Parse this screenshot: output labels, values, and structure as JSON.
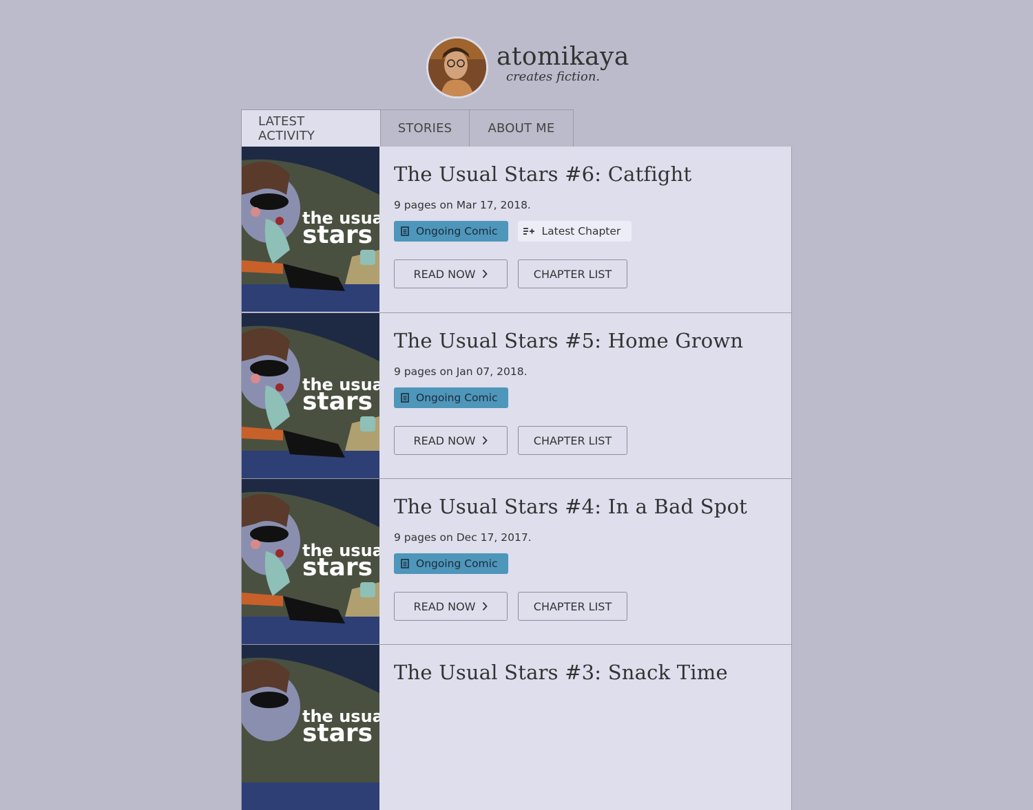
{
  "profile": {
    "name": "atomikaya",
    "tagline": "creates fiction."
  },
  "tabs": [
    {
      "label": "LATEST ACTIVITY",
      "active": true
    },
    {
      "label": "STORIES",
      "active": false
    },
    {
      "label": "ABOUT ME",
      "active": false
    }
  ],
  "entries": [
    {
      "title": "The Usual Stars #6: Catfight",
      "meta": "9 pages on Mar 17, 2018.",
      "badge": "Ongoing Comic",
      "badge_latest": "Latest Chapter",
      "read_label": "READ NOW",
      "chapters_label": "CHAPTER LIST",
      "thumb_text_1": "the usual",
      "thumb_text_2": "stars"
    },
    {
      "title": "The Usual Stars #5: Home Grown",
      "meta": "9 pages on Jan 07, 2018.",
      "badge": "Ongoing Comic",
      "read_label": "READ NOW",
      "chapters_label": "CHAPTER LIST",
      "thumb_text_1": "the usual",
      "thumb_text_2": "stars"
    },
    {
      "title": "The Usual Stars #4: In a Bad Spot",
      "meta": "9 pages on Dec 17, 2017.",
      "badge": "Ongoing Comic",
      "read_label": "READ NOW",
      "chapters_label": "CHAPTER LIST",
      "thumb_text_1": "the usual",
      "thumb_text_2": "stars"
    },
    {
      "title": "The Usual Stars #3: Snack Time",
      "thumb_text_1": "the usual",
      "thumb_text_2": "stars"
    }
  ],
  "colors": {
    "background": "#bbbbcb",
    "panel": "#dedeed",
    "badge_comic": "#4e96ba",
    "badge_latest": "#ededf8"
  },
  "icons": {
    "comic_badge": "document-icon",
    "latest_badge": "playlist-add-icon",
    "read_now": "chevron-right-icon"
  }
}
